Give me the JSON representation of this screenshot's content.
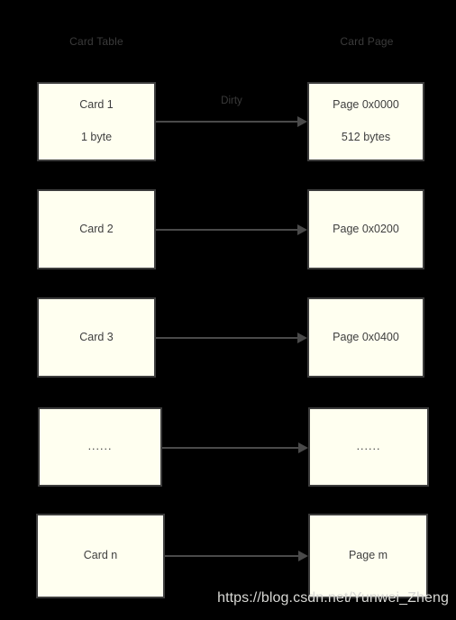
{
  "diagram": {
    "title_left": "Card Table",
    "title_right": "Card Page",
    "background_color": "#000000",
    "box_fill_color": "#FFFFF0",
    "box_border_color": "#3C3C3C",
    "text_color": "#3F3F3F",
    "arrow_color": "#4A4A4A",
    "watermark_color": "#D8D8D4"
  },
  "rows": [
    {
      "left": {
        "line1": "Card 1",
        "line2": "1 byte"
      },
      "right": {
        "line1": "Page 0x0000",
        "line2": "512 bytes"
      },
      "edge_label": "Dirty"
    },
    {
      "left": {
        "line1": "Card 2",
        "line2": ""
      },
      "right": {
        "line1": "Page 0x0200",
        "line2": ""
      },
      "edge_label": ""
    },
    {
      "left": {
        "line1": "Card 3",
        "line2": ""
      },
      "right": {
        "line1": "Page 0x0400",
        "line2": ""
      },
      "edge_label": ""
    },
    {
      "left": {
        "line1": "......",
        "line2": ""
      },
      "right": {
        "line1": "......",
        "line2": ""
      },
      "edge_label": ""
    },
    {
      "left": {
        "line1": "Card n",
        "line2": ""
      },
      "right": {
        "line1": "Page m",
        "line2": ""
      },
      "edge_label": ""
    }
  ],
  "watermark": {
    "text": "https://blog.csdn.net/Yunwei_Zheng"
  }
}
